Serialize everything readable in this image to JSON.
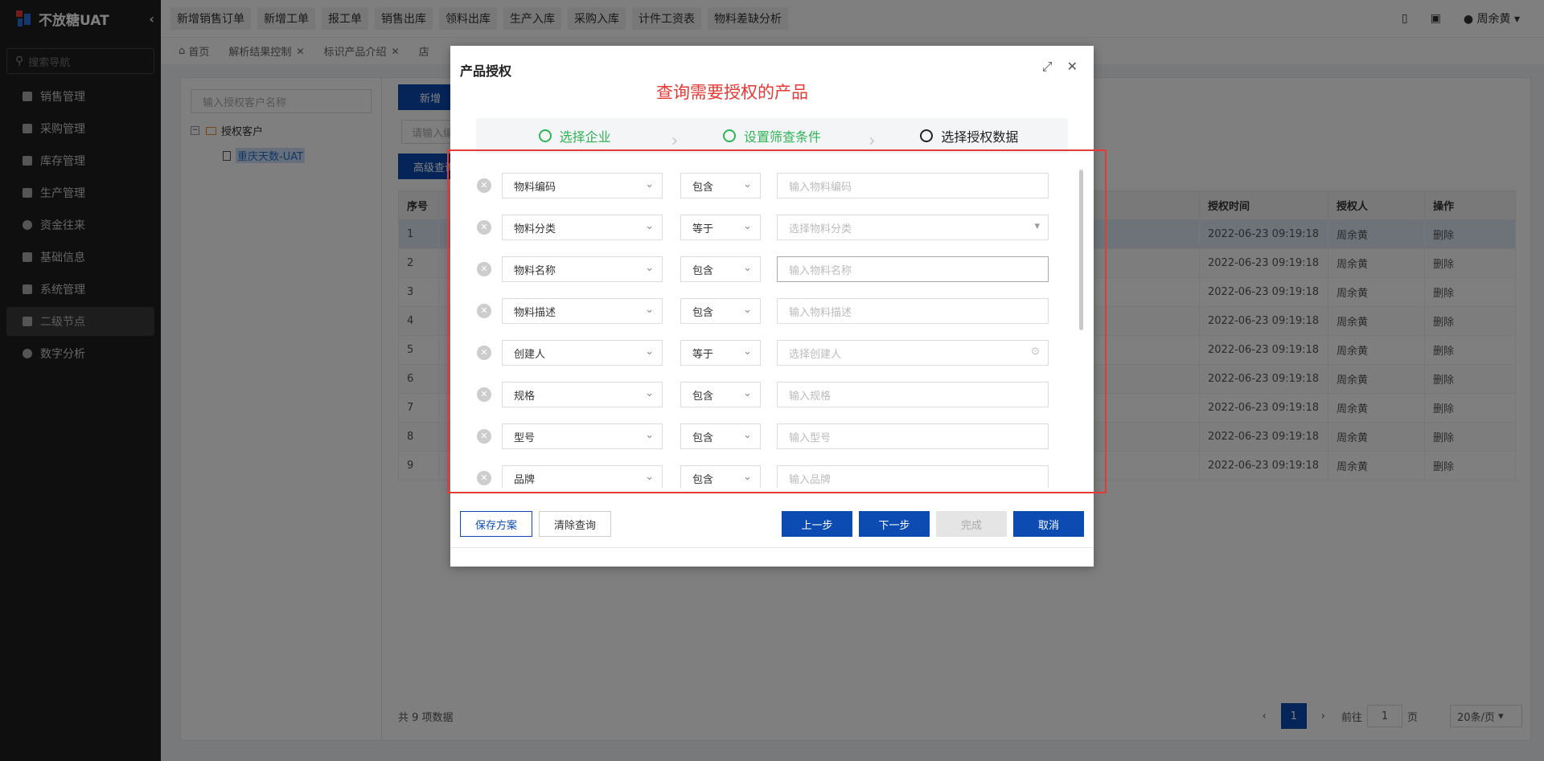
{
  "app": {
    "name": "不放糖UAT"
  },
  "sidebar": {
    "search_placeholder": "搜索导航",
    "items": [
      {
        "label": "销售管理"
      },
      {
        "label": "采购管理"
      },
      {
        "label": "库存管理"
      },
      {
        "label": "生产管理"
      },
      {
        "label": "资金往来"
      },
      {
        "label": "基础信息"
      },
      {
        "label": "系统管理"
      },
      {
        "label": "二级节点"
      },
      {
        "label": "数字分析"
      }
    ]
  },
  "topbar": {
    "quick_links": [
      "新增销售订单",
      "新增工单",
      "报工单",
      "销售出库",
      "领料出库",
      "生产入库",
      "采购入库",
      "计件工资表",
      "物料差缺分析"
    ],
    "user": "周余黄"
  },
  "tabs": [
    {
      "label": "首页"
    },
    {
      "label": "解析结果控制"
    },
    {
      "label": "标识产品介绍"
    },
    {
      "label": "店"
    }
  ],
  "left_panel": {
    "search_placeholder": "输入授权客户名称",
    "root": "授权客户",
    "child": "重庆天数-UAT"
  },
  "toolbar": {
    "new_label": "新增",
    "filter_placeholder": "请输入编",
    "advanced_label": "高级查询"
  },
  "table": {
    "headers": {
      "index": "序号",
      "time": "授权时间",
      "user": "授权人",
      "action": "操作"
    },
    "rows": [
      {
        "no": "1",
        "time": "2022-06-23 09:19:18",
        "user": "周余黄",
        "action": "删除"
      },
      {
        "no": "2",
        "time": "2022-06-23 09:19:18",
        "user": "周余黄",
        "action": "删除"
      },
      {
        "no": "3",
        "time": "2022-06-23 09:19:18",
        "user": "周余黄",
        "action": "删除"
      },
      {
        "no": "4",
        "time": "2022-06-23 09:19:18",
        "user": "周余黄",
        "action": "删除"
      },
      {
        "no": "5",
        "time": "2022-06-23 09:19:18",
        "user": "周余黄",
        "action": "删除"
      },
      {
        "no": "6",
        "time": "2022-06-23 09:19:18",
        "user": "周余黄",
        "action": "删除"
      },
      {
        "no": "7",
        "time": "2022-06-23 09:19:18",
        "user": "周余黄",
        "action": "删除"
      },
      {
        "no": "8",
        "time": "2022-06-23 09:19:18",
        "user": "周余黄",
        "action": "删除"
      },
      {
        "no": "9",
        "time": "2022-06-23 09:19:18",
        "user": "周余黄",
        "action": "删除"
      }
    ]
  },
  "pager": {
    "total": "共 9 项数据",
    "current": "1",
    "goto": "前往",
    "page_value": "1",
    "page_unit": "页",
    "size": "20条/页"
  },
  "modal": {
    "title": "产品授权",
    "annotation": "查询需要授权的产品",
    "steps": [
      {
        "label": "选择企业"
      },
      {
        "label": "设置筛查条件"
      },
      {
        "label": "选择授权数据"
      }
    ],
    "filters": [
      {
        "field": "物料编码",
        "op": "包含",
        "placeholder": "输入物料编码"
      },
      {
        "field": "物料分类",
        "op": "等于",
        "placeholder": "选择物料分类"
      },
      {
        "field": "物料名称",
        "op": "包含",
        "placeholder": "输入物料名称"
      },
      {
        "field": "物料描述",
        "op": "包含",
        "placeholder": "输入物料描述"
      },
      {
        "field": "创建人",
        "op": "等于",
        "placeholder": "选择创建人"
      },
      {
        "field": "规格",
        "op": "包含",
        "placeholder": "输入规格"
      },
      {
        "field": "型号",
        "op": "包含",
        "placeholder": "输入型号"
      },
      {
        "field": "品牌",
        "op": "包含",
        "placeholder": "输入品牌"
      }
    ],
    "buttons": {
      "save_plan": "保存方案",
      "clear": "清除查询",
      "prev": "上一步",
      "next": "下一步",
      "finish": "完成",
      "cancel": "取消"
    }
  },
  "colors": {
    "primary": "#0b4bb2",
    "success": "#2fb456",
    "danger": "#e53935",
    "sidebar_bg": "#1f1f1f"
  }
}
